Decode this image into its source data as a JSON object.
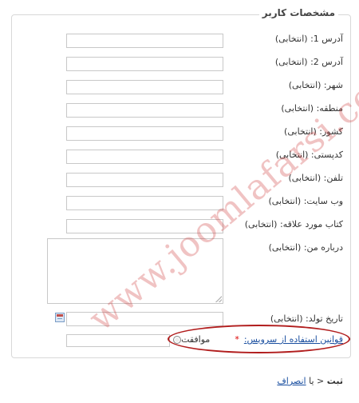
{
  "form": {
    "legend": "مشخصات کاربر",
    "fields": [
      {
        "label": "آدرس 1: (انتخابی)",
        "value": ""
      },
      {
        "label": "آدرس 2: (انتخابی)",
        "value": ""
      },
      {
        "label": "شهر: (انتخابی)",
        "value": ""
      },
      {
        "label": "منطقه: (انتخابی)",
        "value": ""
      },
      {
        "label": "کشور: (انتخابی)",
        "value": ""
      },
      {
        "label": "کدپستی: (انتخابی)",
        "value": ""
      },
      {
        "label": "تلفن: (انتخابی)",
        "value": ""
      },
      {
        "label": "وب سایت: (انتخابی)",
        "value": ""
      },
      {
        "label": "کتاب مورد علاقه: (انتخابی)",
        "value": ""
      }
    ],
    "about": {
      "label": "درباره من: (انتخابی)",
      "value": ""
    },
    "birthdate": {
      "label": "تاریخ تولد: (انتخابی)",
      "value": ""
    },
    "terms": {
      "link_text": "قوانین استفاده از سرویس:",
      "required_mark": "*",
      "agree_label": "موافقت"
    }
  },
  "footer": {
    "save_label": "ثبت",
    "separator": "یا",
    "cancel_label": "انصراف"
  },
  "watermark": "www.joomlafarsi.com",
  "colors": {
    "link": "#1a4fa0",
    "highlight": "#b11d1d",
    "required": "#dd0000",
    "watermark": "#c82828"
  }
}
